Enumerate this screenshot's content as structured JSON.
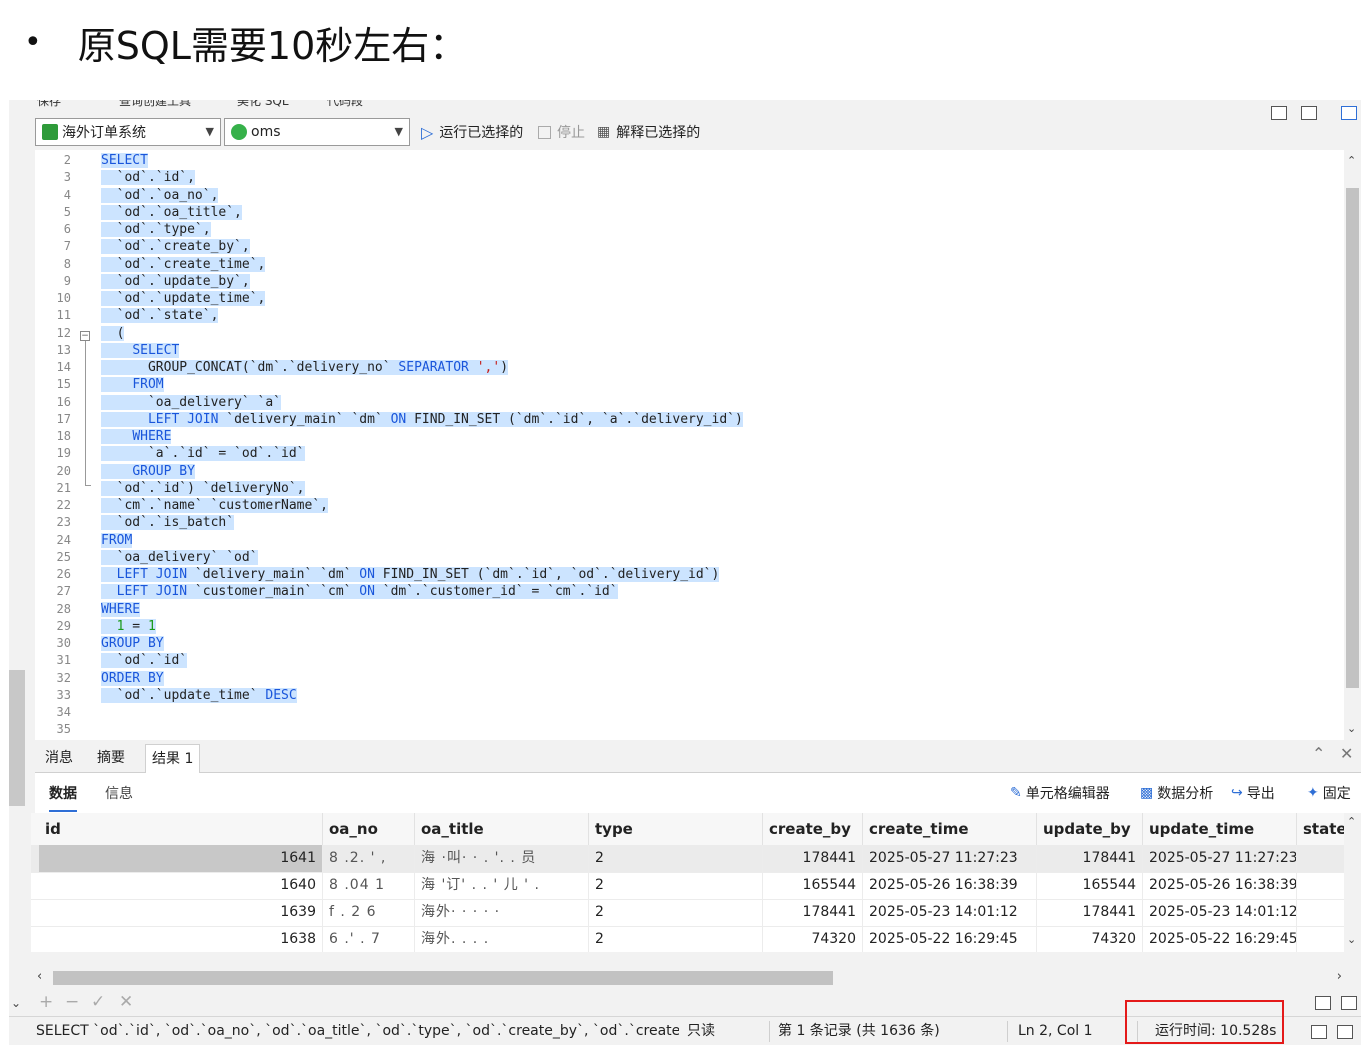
{
  "slide": {
    "bullet": "•",
    "title": "原SQL需要10秒左右："
  },
  "toprow": {
    "items": [
      "保存",
      "查询创建工具",
      "美化 SQL",
      "代码段"
    ]
  },
  "toolbar": {
    "connection": "海外订单系统",
    "database": "oms",
    "run_selected": "运行已选择的",
    "stop": "停止",
    "explain_selected": "解释已选择的"
  },
  "editor": {
    "lines": [
      {
        "n": "2",
        "text": "SELECT"
      },
      {
        "n": "3",
        "text": "  `od`.`id`,"
      },
      {
        "n": "4",
        "text": "  `od`.`oa_no`,"
      },
      {
        "n": "5",
        "text": "  `od`.`oa_title`,"
      },
      {
        "n": "6",
        "text": "  `od`.`type`,"
      },
      {
        "n": "7",
        "text": "  `od`.`create_by`,"
      },
      {
        "n": "8",
        "text": "  `od`.`create_time`,"
      },
      {
        "n": "9",
        "text": "  `od`.`update_by`,"
      },
      {
        "n": "10",
        "text": "  `od`.`update_time`,"
      },
      {
        "n": "11",
        "text": "  `od`.`state`,"
      },
      {
        "n": "12",
        "text": "  ("
      },
      {
        "n": "13",
        "text": "    SELECT"
      },
      {
        "n": "14",
        "text": "      GROUP_CONCAT(`dm`.`delivery_no` SEPARATOR ',')"
      },
      {
        "n": "15",
        "text": "    FROM"
      },
      {
        "n": "16",
        "text": "      `oa_delivery` `a`"
      },
      {
        "n": "17",
        "text": "      LEFT JOIN `delivery_main` `dm` ON FIND_IN_SET (`dm`.`id`, `a`.`delivery_id`)"
      },
      {
        "n": "18",
        "text": "    WHERE"
      },
      {
        "n": "19",
        "text": "      `a`.`id` = `od`.`id`"
      },
      {
        "n": "20",
        "text": "    GROUP BY"
      },
      {
        "n": "21",
        "text": "  `od`.`id`) `deliveryNo`,"
      },
      {
        "n": "22",
        "text": "  `cm`.`name` `customerName`,"
      },
      {
        "n": "23",
        "text": "  `od`.`is_batch`"
      },
      {
        "n": "24",
        "text": "FROM"
      },
      {
        "n": "25",
        "text": "  `oa_delivery` `od`"
      },
      {
        "n": "26",
        "text": "  LEFT JOIN `delivery_main` `dm` ON FIND_IN_SET (`dm`.`id`, `od`.`delivery_id`)"
      },
      {
        "n": "27",
        "text": "  LEFT JOIN `customer_main` `cm` ON `dm`.`customer_id` = `cm`.`id`"
      },
      {
        "n": "28",
        "text": "WHERE"
      },
      {
        "n": "29",
        "text": "  1 = 1"
      },
      {
        "n": "30",
        "text": "GROUP BY"
      },
      {
        "n": "31",
        "text": "  `od`.`id`"
      },
      {
        "n": "32",
        "text": "ORDER BY"
      },
      {
        "n": "33",
        "text": "  `od`.`update_time` DESC"
      },
      {
        "n": "34",
        "text": ""
      },
      {
        "n": "35",
        "text": ""
      }
    ]
  },
  "result_tabs": {
    "messages": "消息",
    "summary": "摘要",
    "result1": "结果 1"
  },
  "sub_tabs": {
    "data": "数据",
    "info": "信息",
    "cell_editor": "单元格编辑器",
    "data_analysis": "数据分析",
    "export": "导出",
    "pin": "固定"
  },
  "grid": {
    "columns": [
      "id",
      "oa_no",
      "oa_title",
      "type",
      "create_by",
      "create_time",
      "update_by",
      "update_time",
      "state"
    ],
    "rows": [
      [
        "1641",
        "8 .2. ' ,",
        "海 ·叫· ·  . '. . 员",
        "2",
        "178441",
        "2025-05-27 11:27:23",
        "178441",
        "2025-05-27 11:27:23"
      ],
      [
        "1640",
        "8 .04 1",
        "海 '订' .  .  ' 儿 ' .",
        "2",
        "165544",
        "2025-05-26 16:38:39",
        "165544",
        "2025-05-26 16:38:39"
      ],
      [
        "1639",
        "f . 2 6",
        "海外·  ·  ·  ·  ·",
        "2",
        "178441",
        "2025-05-23 14:01:12",
        "178441",
        "2025-05-23 14:01:12"
      ],
      [
        "1638",
        "6 .' . 7",
        "海外.  .  .  .",
        "2",
        "74320",
        "2025-05-22 16:29:45",
        "74320",
        "2025-05-22 16:29:45"
      ]
    ]
  },
  "actions": [
    "+",
    "−",
    "✓",
    "✕"
  ],
  "status": {
    "sql": "SELECT `od`.`id`, `od`.`oa_no`, `od`.`oa_title`, `od`.`type`, `od`.`create_by`, `od`.`create_ti",
    "readonly": "只读",
    "records": "第 1 条记录 (共 1636 条)",
    "cursor": "Ln 2, Col 1",
    "runtime": "运行时间: 10.528s"
  },
  "colors": {
    "selection": "#cce4ff",
    "keyword": "#1a56db",
    "number": "#1a9a1a",
    "string": "#c41a16",
    "highlight_box": "#e41a1a"
  }
}
